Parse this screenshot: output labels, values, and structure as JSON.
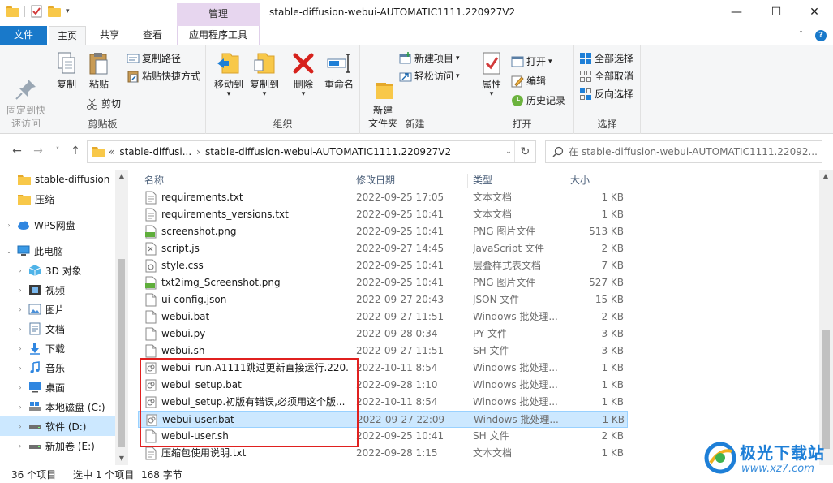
{
  "window": {
    "title": "stable-diffusion-webui-AUTOMATIC1111.220927V2",
    "tool_tab_header": "管理",
    "minimize": "—",
    "maximize": "☐",
    "close": "✕"
  },
  "ribbon_tabs": [
    {
      "label": "文件"
    },
    {
      "label": "主页"
    },
    {
      "label": "共享"
    },
    {
      "label": "查看"
    },
    {
      "label": "应用程序工具"
    }
  ],
  "ribbon": {
    "clipboard": {
      "label": "剪贴板",
      "pin_quick_access": "固定到快\n速访问",
      "copy": "复制",
      "paste": "粘贴",
      "copy_path": "复制路径",
      "paste_shortcut": "粘贴快捷方式",
      "cut": "剪切"
    },
    "organize": {
      "label": "组织",
      "move_to": "移动到",
      "copy_to": "复制到",
      "delete": "删除",
      "rename": "重命名"
    },
    "new": {
      "label": "新建",
      "new_folder": "新建\n文件夹",
      "new_item": "新建项目",
      "easy_access": "轻松访问"
    },
    "open": {
      "label": "打开",
      "properties": "属性",
      "open": "打开",
      "edit": "编辑",
      "history": "历史记录"
    },
    "select": {
      "label": "选择",
      "select_all": "全部选择",
      "select_none": "全部取消",
      "invert": "反向选择"
    }
  },
  "address": {
    "prefix": "«",
    "crumbs": [
      "stable-diffusi...",
      "›",
      "stable-diffusion-webui-AUTOMATIC1111.220927V2"
    ],
    "dropdown": "⌄",
    "refresh": "↻"
  },
  "search": {
    "placeholder": "在 stable-diffusion-webui-AUTOMATIC1111.22092..."
  },
  "nav_pane": {
    "items": [
      {
        "label": "stable-diffusion",
        "icon": "folder-icon"
      },
      {
        "label": "压缩",
        "icon": "folder-icon"
      },
      {
        "label": "WPS网盘",
        "icon": "cloud-icon"
      },
      {
        "label": "此电脑",
        "icon": "pc-icon"
      },
      {
        "label": "3D 对象",
        "icon": "cube-icon"
      },
      {
        "label": "视频",
        "icon": "video-icon"
      },
      {
        "label": "图片",
        "icon": "picture-icon"
      },
      {
        "label": "文档",
        "icon": "document-icon"
      },
      {
        "label": "下载",
        "icon": "download-icon"
      },
      {
        "label": "音乐",
        "icon": "music-icon"
      },
      {
        "label": "桌面",
        "icon": "desktop-icon"
      },
      {
        "label": "本地磁盘 (C:)",
        "icon": "drive-c-icon"
      },
      {
        "label": "软件 (D:)",
        "icon": "drive-icon"
      },
      {
        "label": "新加卷 (E:)",
        "icon": "drive-icon"
      }
    ]
  },
  "columns": {
    "name": "名称",
    "date": "修改日期",
    "type": "类型",
    "size": "大小"
  },
  "files": [
    {
      "name": "requirements.txt",
      "date": "2022-09-25 17:05",
      "type": "文本文档",
      "size": "1 KB",
      "icon": "text-file-icon"
    },
    {
      "name": "requirements_versions.txt",
      "date": "2022-09-25 10:41",
      "type": "文本文档",
      "size": "1 KB",
      "icon": "text-file-icon"
    },
    {
      "name": "screenshot.png",
      "date": "2022-09-25 10:41",
      "type": "PNG 图片文件",
      "size": "513 KB",
      "icon": "png-file-icon"
    },
    {
      "name": "script.js",
      "date": "2022-09-27 14:45",
      "type": "JavaScript 文件",
      "size": "2 KB",
      "icon": "js-file-icon"
    },
    {
      "name": "style.css",
      "date": "2022-09-25 10:41",
      "type": "层叠样式表文档",
      "size": "7 KB",
      "icon": "css-file-icon"
    },
    {
      "name": "txt2img_Screenshot.png",
      "date": "2022-09-25 10:41",
      "type": "PNG 图片文件",
      "size": "527 KB",
      "icon": "png-file-icon"
    },
    {
      "name": "ui-config.json",
      "date": "2022-09-27 20:43",
      "type": "JSON 文件",
      "size": "15 KB",
      "icon": "blank-file-icon"
    },
    {
      "name": "webui.bat",
      "date": "2022-09-27 11:51",
      "type": "Windows 批处理...",
      "size": "2 KB",
      "icon": "blank-file-icon"
    },
    {
      "name": "webui.py",
      "date": "2022-09-28 0:34",
      "type": "PY 文件",
      "size": "3 KB",
      "icon": "blank-file-icon"
    },
    {
      "name": "webui.sh",
      "date": "2022-09-27 11:51",
      "type": "SH 文件",
      "size": "3 KB",
      "icon": "blank-file-icon"
    },
    {
      "name": "webui_run.A1111跳过更新直接运行.220...",
      "date": "2022-10-11 8:54",
      "type": "Windows 批处理...",
      "size": "1 KB",
      "icon": "bat-file-icon"
    },
    {
      "name": "webui_setup.bat",
      "date": "2022-09-28 1:10",
      "type": "Windows 批处理...",
      "size": "1 KB",
      "icon": "bat-file-icon"
    },
    {
      "name": "webui_setup.初版有错误,必须用这个版...",
      "date": "2022-10-11 8:54",
      "type": "Windows 批处理...",
      "size": "1 KB",
      "icon": "bat-file-icon"
    },
    {
      "name": "webui-user.bat",
      "date": "2022-09-27 22:09",
      "type": "Windows 批处理...",
      "size": "1 KB",
      "icon": "bat-file-icon",
      "selected": true
    },
    {
      "name": "webui-user.sh",
      "date": "2022-09-25 10:41",
      "type": "SH 文件",
      "size": "2 KB",
      "icon": "blank-file-icon"
    },
    {
      "name": "压缩包使用说明.txt",
      "date": "2022-09-28 1:15",
      "type": "文本文档",
      "size": "1 KB",
      "icon": "text-file-icon"
    }
  ],
  "status": {
    "item_count": "36 个项目",
    "selection": "选中 1 个项目",
    "selection_size": "168 字节"
  },
  "watermark": {
    "title": "极光下载站",
    "url": "www.xz7.com"
  },
  "colors": {
    "accent": "#1979ca",
    "selection": "#cce8ff",
    "highlight_box": "#e0201f",
    "tool_tab": "#e7d6ef"
  }
}
